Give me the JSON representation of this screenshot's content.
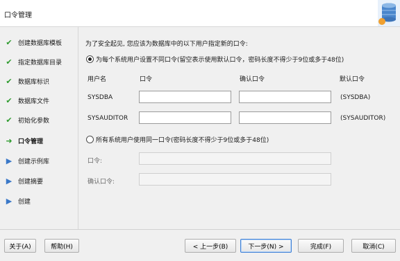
{
  "header": {
    "title": "口令管理"
  },
  "steps": [
    {
      "label": "创建数据库模板",
      "state": "done"
    },
    {
      "label": "指定数据库目录",
      "state": "done"
    },
    {
      "label": "数据库标识",
      "state": "done"
    },
    {
      "label": "数据库文件",
      "state": "done"
    },
    {
      "label": "初始化参数",
      "state": "done"
    },
    {
      "label": "口令管理",
      "state": "current"
    },
    {
      "label": "创建示例库",
      "state": "todo"
    },
    {
      "label": "创建摘要",
      "state": "todo"
    },
    {
      "label": "创建",
      "state": "todo"
    }
  ],
  "main": {
    "intro": "为了安全起见, 您应该为数据库中的以下用户指定新的口令:",
    "option_individual": "为每个系统用户设置不同口令(留空表示使用默认口令，密码长度不得少于9位或多于48位)",
    "columns": {
      "user": "用户名",
      "password": "口令",
      "confirm": "确认口令",
      "default": "默认口令"
    },
    "users": [
      {
        "name": "SYSDBA",
        "password": "",
        "confirm": "",
        "default": "(SYSDBA)"
      },
      {
        "name": "SYSAUDITOR",
        "password": "",
        "confirm": "",
        "default": "(SYSAUDITOR)"
      }
    ],
    "option_shared": "所有系统用户使用同一口令(密码长度不得少于9位或多于48位)",
    "shared_password_label": "口令:",
    "shared_confirm_label": "确认口令:",
    "selected_option": "individual"
  },
  "footer": {
    "about": "关于(A)",
    "help": "帮助(H)",
    "back": "< 上一步(B)",
    "next": "下一步(N) >",
    "finish": "完成(F)",
    "cancel": "取消(C)"
  },
  "colors": {
    "done_check": "#2e9b2e",
    "todo_arrow": "#3a78c8",
    "primary_border": "#3c7fd6"
  },
  "icons": {
    "done": "check-icon",
    "current": "arrow-right-icon",
    "todo": "double-chevron-icon"
  }
}
